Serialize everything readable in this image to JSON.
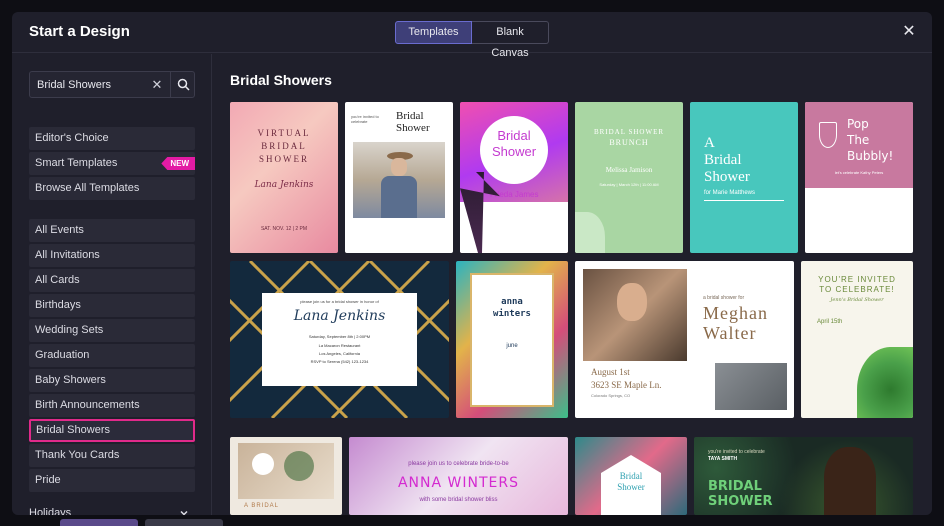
{
  "header": {
    "title": "Start a Design",
    "tab_templates": "Templates",
    "tab_blank": "Blank Canvas",
    "close_symbol": "✕"
  },
  "search": {
    "value": "Bridal Showers",
    "clear_symbol": "✕"
  },
  "sidebar": {
    "group1": [
      {
        "label": "Editor's Choice"
      },
      {
        "label": "Smart Templates",
        "badge": "NEW"
      },
      {
        "label": "Browse All Templates"
      }
    ],
    "group2": [
      {
        "label": "All Events"
      },
      {
        "label": "All Invitations"
      },
      {
        "label": "All Cards"
      },
      {
        "label": "Birthdays"
      },
      {
        "label": "Wedding Sets"
      },
      {
        "label": "Graduation"
      },
      {
        "label": "Baby Showers"
      },
      {
        "label": "Birth Announcements"
      },
      {
        "label": "Bridal Showers"
      },
      {
        "label": "Thank You Cards"
      },
      {
        "label": "Pride"
      }
    ],
    "holidays": "Holidays"
  },
  "content": {
    "section_title": "Bridal Showers"
  },
  "cards": {
    "c1": {
      "l1": "VIRTUAL",
      "l2": "BRIDAL",
      "l3": "SHOWER",
      "name": "Lana Jenkins",
      "date": "SAT. NOV. 12 | 2 PM"
    },
    "c2": {
      "l1": "Bridal",
      "l2": "Shower",
      "small": "you're invited to celebrate"
    },
    "c3": {
      "l1": "Bridal",
      "l2": "Shower",
      "name": "Frieda James"
    },
    "c4": {
      "l1": "BRIDAL SHOWER",
      "l2": "BRUNCH",
      "name": "Melissa Jamison",
      "date": "Saturday | March 12th | 11:00 AM"
    },
    "c5": {
      "l1": "A",
      "l2": "Bridal",
      "l3": "Shower",
      "name": "for Marie Matthews"
    },
    "c6": {
      "l1": "Pop",
      "l2": "The",
      "l3": "Bubbly!",
      "small": "let's celebrate Kathy Peters"
    },
    "c7": {
      "small": "please join us for a bridal shower in honor of",
      "name": "Lana Jenkins",
      "date": "Saturday, September 8th | 2:00PM",
      "place": "La Macaron Restaurant",
      "city": "Los Angeles, California",
      "rsvp": "RSVP to Serena (542) 123-1234"
    },
    "c8": {
      "l1": "anna",
      "l2": "winters",
      "date": "june"
    },
    "c9": {
      "small": "a bridal shower for",
      "l1": "Meghan",
      "l2": "Walter",
      "date": "August 1st",
      "addr": "3623 SE Maple Ln.",
      "city": "Colorado Springs, CO"
    },
    "c10": {
      "l1": "YOU'RE INVITED",
      "l2": "TO CELEBRATE!",
      "name": "Jenn's Bridal Shower",
      "date": "April 15th"
    },
    "c11": {
      "l1": "A BRIDAL"
    },
    "c12": {
      "small": "please join us to celebrate bride-to-be",
      "name": "ANNA WINTERS",
      "sub": "with some bridal shower bliss"
    },
    "c13": {
      "l1": "Bridal",
      "l2": "Shower"
    },
    "c14": {
      "small": "you're invited to celebrate",
      "name": "TAYA SMITH",
      "l1": "BRIDAL",
      "l2": "SHOWER"
    }
  },
  "colors": {
    "accent": "#3e3f78",
    "selected_border": "#e02a8a",
    "badge": "#e31ba4"
  }
}
